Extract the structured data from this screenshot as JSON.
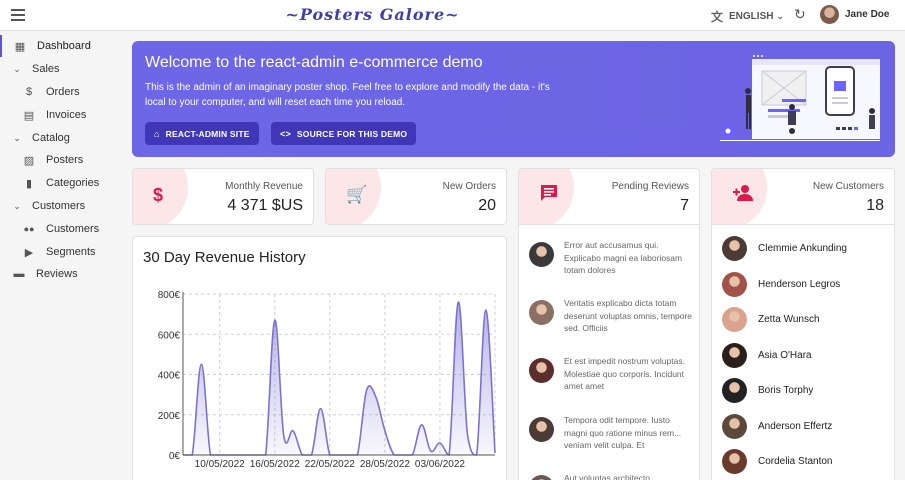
{
  "app": {
    "brand": "~Posters Galore~",
    "language": "ENGLISH",
    "user_name": "Jane Doe"
  },
  "sidebar": {
    "items": [
      {
        "label": "Dashboard",
        "icon": "dashboard-icon",
        "glyph": "▦"
      },
      {
        "label": "Sales",
        "icon": "chevron-down-icon",
        "glyph": "⌄"
      },
      {
        "label": "Orders",
        "icon": "dollar-icon",
        "glyph": "$"
      },
      {
        "label": "Invoices",
        "icon": "invoice-icon",
        "glyph": "▤"
      },
      {
        "label": "Catalog",
        "icon": "chevron-down-icon",
        "glyph": "⌄"
      },
      {
        "label": "Posters",
        "icon": "image-icon",
        "glyph": "▨"
      },
      {
        "label": "Categories",
        "icon": "bookmark-icon",
        "glyph": "▮"
      },
      {
        "label": "Customers",
        "icon": "chevron-down-icon",
        "glyph": "⌄"
      },
      {
        "label": "Customers",
        "icon": "people-icon",
        "glyph": "👥"
      },
      {
        "label": "Segments",
        "icon": "label-icon",
        "glyph": "▶"
      },
      {
        "label": "Reviews",
        "icon": "comment-icon",
        "glyph": "▬"
      }
    ]
  },
  "banner": {
    "title": "Welcome to the react-admin e-commerce demo",
    "text": "This is the admin of an imaginary poster shop. Feel free to explore and modify the data - it's local to your computer, and will reset each time you reload.",
    "button_site": "REACT-ADMIN SITE",
    "button_source": "SOURCE FOR THIS DEMO"
  },
  "stats": {
    "revenue_label": "Monthly Revenue",
    "revenue_value": "4 371 $US",
    "orders_label": "New Orders",
    "orders_value": "20",
    "reviews_label": "Pending Reviews",
    "reviews_value": "7",
    "customers_label": "New Customers",
    "customers_value": "18"
  },
  "reviews": [
    {
      "text": "Error aut accusamus qui. Explicabo magni ea laboriosam totam dolores",
      "color": "#3a3a3a"
    },
    {
      "text": "Veritatis explicabo dicta totam deserunt voluptas omnis, tempore sed. Officiis",
      "color": "#8a6f62"
    },
    {
      "text": "Et est impedit nostrum voluptas. Molestiae quo corporis. Incidunt amet amet",
      "color": "#5a2e2a"
    },
    {
      "text": "Tempora odit tempore. Iusto magni quo ratione minus rem... veniam velit culpa. Et",
      "color": "#4a3b36"
    },
    {
      "text": "Aut voluptas architecto",
      "color": "#6b5a52"
    }
  ],
  "customers": [
    {
      "name": "Clemmie Ankunding",
      "color": "#4b3b34"
    },
    {
      "name": "Henderson Legros",
      "color": "#a3524a"
    },
    {
      "name": "Zetta Wunsch",
      "color": "#d9a38e"
    },
    {
      "name": "Asia O'Hara",
      "color": "#2b1f1c"
    },
    {
      "name": "Boris Torphy",
      "color": "#222222"
    },
    {
      "name": "Anderson Effertz",
      "color": "#5b4a3c"
    },
    {
      "name": "Cordelia Stanton",
      "color": "#6a3a2c"
    }
  ],
  "chart_data": {
    "type": "area",
    "title": "30 Day Revenue History",
    "x": [
      "2022-05-06",
      "2022-05-07",
      "2022-05-08",
      "2022-05-09",
      "2022-05-10",
      "2022-05-11",
      "2022-05-12",
      "2022-05-13",
      "2022-05-14",
      "2022-05-15",
      "2022-05-16",
      "2022-05-17",
      "2022-05-18",
      "2022-05-19",
      "2022-05-20",
      "2022-05-21",
      "2022-05-22",
      "2022-05-23",
      "2022-05-24",
      "2022-05-25",
      "2022-05-26",
      "2022-05-27",
      "2022-05-28",
      "2022-05-29",
      "2022-05-30",
      "2022-05-31",
      "2022-06-01",
      "2022-06-02",
      "2022-06-03",
      "2022-06-04",
      "2022-06-05",
      "2022-06-06",
      "2022-06-07",
      "2022-06-08",
      "2022-06-09"
    ],
    "values": [
      0,
      0,
      450,
      0,
      0,
      0,
      0,
      0,
      0,
      0,
      670,
      90,
      120,
      0,
      0,
      230,
      0,
      0,
      0,
      0,
      320,
      290,
      120,
      0,
      0,
      0,
      150,
      20,
      60,
      0,
      760,
      100,
      0,
      720,
      10
    ],
    "xticks": [
      "10/05/2022",
      "16/05/2022",
      "22/05/2022",
      "28/05/2022",
      "03/06/2022"
    ],
    "yticks": [
      "0€",
      "200€",
      "400€",
      "600€",
      "800€"
    ],
    "ylim": [
      0,
      800
    ],
    "grid": true,
    "color": "#7b72d4"
  }
}
